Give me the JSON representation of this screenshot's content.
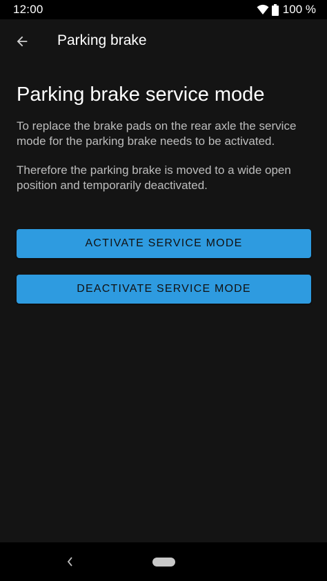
{
  "status_bar": {
    "time": "12:00",
    "battery": "100 %",
    "icons": [
      "wifi-icon",
      "battery-icon"
    ]
  },
  "app_bar": {
    "back_icon": "arrow-back-icon",
    "title": "Parking brake"
  },
  "content": {
    "heading": "Parking brake service mode",
    "paragraph1": "To replace the brake pads on the rear axle the service mode for the parking brake needs to be activated.",
    "paragraph2": "Therefore the parking brake is moved to a wide open position and temporarily deactivated."
  },
  "buttons": {
    "activate": "ACTIVATE SERVICE MODE",
    "deactivate": "DEACTIVATE SERVICE MODE"
  },
  "nav_bar": {
    "back_icon": "nav-back-icon",
    "home_icon": "home-pill-icon"
  },
  "colors": {
    "background": "#141414",
    "button": "#2e9be0",
    "body_text": "#bdbdbd"
  }
}
